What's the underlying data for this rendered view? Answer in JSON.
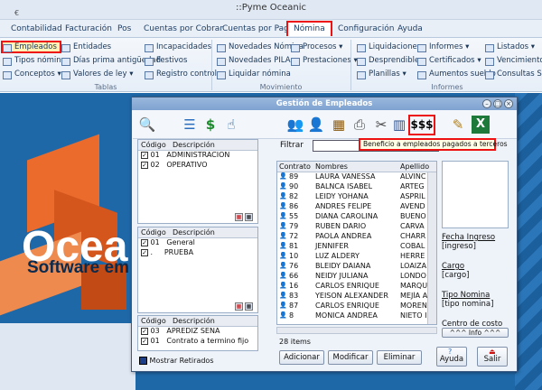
{
  "window": {
    "title": "::Pyme Oceanic",
    "qat": "€"
  },
  "menu": [
    "Contabilidad",
    "Facturación",
    "Pos",
    "Cuentas por Cobrar",
    "Cuentas por Pagar",
    "Nómina",
    "Configuración",
    "Ayuda"
  ],
  "menu_active": "Nómina",
  "ribbon": {
    "tablas": {
      "label": "Tablas",
      "items": [
        "Empleados",
        "Tipos nómina",
        "Conceptos",
        "Entidades",
        "Días prima antigüedad",
        "Valores de ley",
        "Incapacidades",
        "Festivos",
        "Registro control"
      ]
    },
    "movimiento": {
      "label": "Movimiento",
      "items": [
        "Novedades Nómina",
        "Novedades PILA",
        "Liquidar nómina",
        "Procesos",
        "Prestaciones"
      ]
    },
    "informes": {
      "label": "Informes",
      "items": [
        "Liquidaciones",
        "Desprendibles",
        "Planillas",
        "Informes",
        "Certificados",
        "Aumentos sueldo",
        "Listados",
        "Vencimiento co",
        "Consultas SQL"
      ]
    }
  },
  "brand": {
    "name": "Ocea",
    "slogan": "Software em"
  },
  "dialog": {
    "title": "Gestión de Empleados",
    "filter_label": "Filtrar",
    "filter_value": "",
    "tooltip": "Beneficio a empleados pagados a terceros",
    "panels": [
      {
        "h1": "Código",
        "h2": "Descripción",
        "rows": [
          {
            "code": "01",
            "desc": "ADMINISTRACION"
          },
          {
            "code": "02",
            "desc": "OPERATIVO"
          }
        ]
      },
      {
        "h1": "Código",
        "h2": "Descripción",
        "rows": [
          {
            "code": "01",
            "desc": "General"
          },
          {
            "code": ".",
            "desc": "PRUEBA"
          }
        ]
      },
      {
        "h1": "Código",
        "h2": "Descripción",
        "rows": [
          {
            "code": "03",
            "desc": "APREDIZ SENA"
          },
          {
            "code": "01",
            "desc": "Contrato a termino fijo"
          }
        ]
      }
    ],
    "grid": {
      "headers": [
        "Contrato",
        "Nombres",
        "Apellido"
      ],
      "rows": [
        [
          "89",
          "LAURA VANESSA",
          "ALVINC"
        ],
        [
          "90",
          "BALNCA ISABEL",
          "ARTEG"
        ],
        [
          "82",
          "LEIDY YOHANA",
          "ASPRIL"
        ],
        [
          "86",
          "ANDRES FELIPE",
          "AVEND"
        ],
        [
          "55",
          "DIANA CAROLINA",
          "BUENO"
        ],
        [
          "79",
          "RUBEN DARIO",
          "CARVA"
        ],
        [
          "72",
          "PAOLA ANDREA",
          "CHARR"
        ],
        [
          "81",
          "JENNIFER",
          "COBAL"
        ],
        [
          "10",
          "LUZ ALDERY",
          "HERRE"
        ],
        [
          "76",
          "BLEIDY DAIANA",
          "LOAIZA"
        ],
        [
          "66",
          "NEIDY JULIANA",
          "LONDO"
        ],
        [
          "16",
          "CARLOS ENRIQUE",
          "MARQU"
        ],
        [
          "83",
          "YEISON ALEXANDER",
          "MEJÍA A"
        ],
        [
          "87",
          "CARLOS ENRIQUE",
          "MOREN"
        ],
        [
          "8",
          "MONICA ANDREA",
          "NIETO I"
        ]
      ]
    },
    "count": "28 items",
    "mostrar_retirados": "Mostrar Retirados",
    "buttons": {
      "adicionar": "Adicionar",
      "modificar": "Modificar",
      "eliminar": "Eliminar",
      "ayuda": "Ayuda",
      "salir": "Salir",
      "info": "^^^ Info ^^^"
    },
    "details": [
      {
        "label": "Fecha Ingreso",
        "value": "[ingreso]"
      },
      {
        "label": "Cargo",
        "value": "[cargo]"
      },
      {
        "label": "Tipo Nomina",
        "value": "[tipo nomina]"
      },
      {
        "label": "Centro de costo",
        "value": ""
      }
    ]
  },
  "colors": {
    "accent": "#e11111",
    "desktop": "#1f68a8",
    "logo": "#ea6b2b"
  }
}
